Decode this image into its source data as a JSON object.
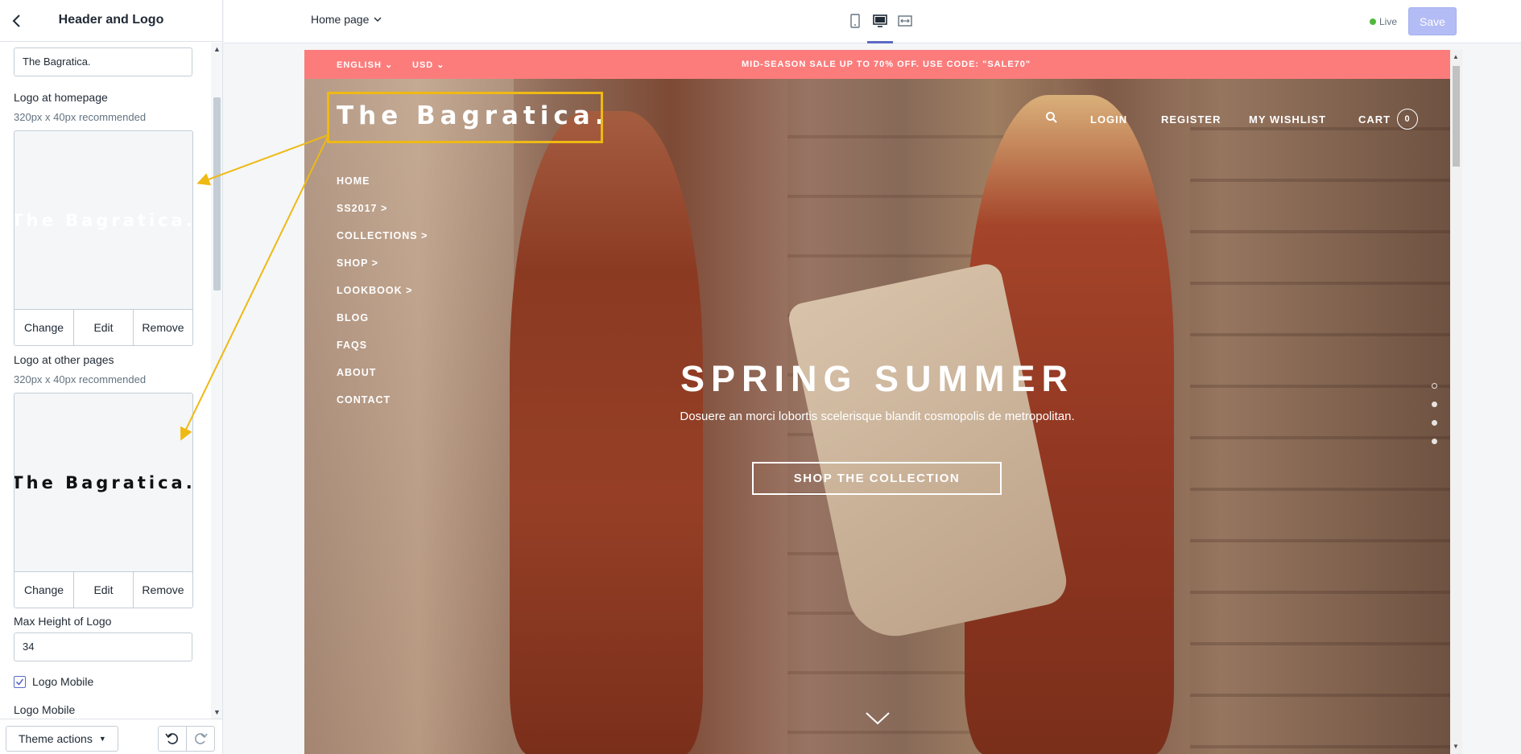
{
  "sidebar": {
    "title": "Header and Logo",
    "store_name_value": "The Bagratica.",
    "logo_home": {
      "label": "Logo at homepage",
      "hint": "320px x 40px recommended",
      "logo_text": "The Bagratica.",
      "buttons": [
        "Change",
        "Edit",
        "Remove"
      ]
    },
    "logo_other": {
      "label": "Logo at other pages",
      "hint": "320px x 40px recommended",
      "logo_text": "The Bagratica.",
      "buttons": [
        "Change",
        "Edit",
        "Remove"
      ]
    },
    "max_height": {
      "label": "Max Height of Logo",
      "value": "34"
    },
    "logo_mobile_checkbox": {
      "label": "Logo Mobile",
      "checked": true
    },
    "logo_mobile_section_label": "Logo Mobile",
    "theme_actions": "Theme actions"
  },
  "topbar": {
    "page_select": "Home page",
    "live_label": "Live",
    "save_label": "Save",
    "active_device": "desktop"
  },
  "store": {
    "announcement": {
      "language": "ENGLISH",
      "currency": "USD",
      "promo": "MID-SEASON SALE UP TO 70% OFF. USE CODE: \"SALE70\""
    },
    "logo_text": "The Bagratica.",
    "top_nav": {
      "login": "LOGIN",
      "register": "REGISTER",
      "wishlist": "MY WISHLIST",
      "cart": "CART",
      "cart_count": "0"
    },
    "side_nav": [
      "HOME",
      "SS2017 >",
      "COLLECTIONS >",
      "SHOP >",
      "LOOKBOOK >",
      "BLOG",
      "FAQS",
      "ABOUT",
      "CONTACT"
    ],
    "hero": {
      "title": "SPRING SUMMER",
      "subtitle": "Dosuere an morci lobortis scelerisque blandit cosmopolis de metropolitan.",
      "button": "SHOP THE COLLECTION",
      "slide_count": 4
    }
  },
  "colors": {
    "announcement_bg": "#fc7c7c",
    "highlight": "#efb913",
    "save_button": "#b3bcf5",
    "live_dot": "#50b83c"
  }
}
